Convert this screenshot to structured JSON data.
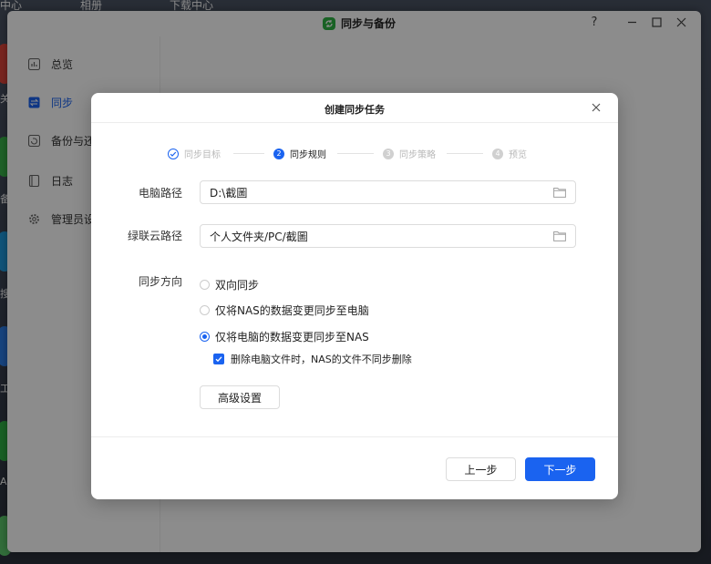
{
  "desktop": {
    "top_labels": [
      "中心",
      "相册",
      "下载中心"
    ],
    "dock_letters": [
      "关",
      "备",
      "搜",
      "工",
      "A"
    ]
  },
  "window": {
    "title": "同步与备份",
    "controls": {
      "help": "?",
      "minimize": "—",
      "maximize": "☐",
      "close": "✕"
    },
    "sidebar": {
      "items": [
        {
          "label": "总览",
          "icon": "overview-icon"
        },
        {
          "label": "同步",
          "icon": "sync-icon",
          "active": true
        },
        {
          "label": "备份与还",
          "icon": "backup-icon"
        },
        {
          "label": "日志",
          "icon": "log-icon"
        },
        {
          "label": "管理员设",
          "icon": "admin-settings-icon"
        }
      ]
    }
  },
  "dialog": {
    "title": "创建同步任务",
    "steps": [
      {
        "num": "1",
        "label": "同步目标",
        "state": "done"
      },
      {
        "num": "2",
        "label": "同步规则",
        "state": "current"
      },
      {
        "num": "3",
        "label": "同步策略",
        "state": "pending"
      },
      {
        "num": "4",
        "label": "预览",
        "state": "pending"
      }
    ],
    "computer_path": {
      "label": "电脑路径",
      "value": "D:\\截圖"
    },
    "cloud_path": {
      "label": "绿联云路径",
      "value": "个人文件夹/PC/截圖"
    },
    "direction": {
      "label": "同步方向",
      "options": [
        {
          "label": "双向同步",
          "checked": false
        },
        {
          "label": "仅将NAS的数据变更同步至电脑",
          "checked": false
        },
        {
          "label": "仅将电脑的数据变更同步至NAS",
          "checked": true
        }
      ],
      "sub_option": {
        "label": "删除电脑文件时，NAS的文件不同步删除",
        "checked": true
      }
    },
    "advanced_button": "高级设置",
    "prev_button": "上一步",
    "next_button": "下一步",
    "accent_color": "#1a63f0"
  }
}
